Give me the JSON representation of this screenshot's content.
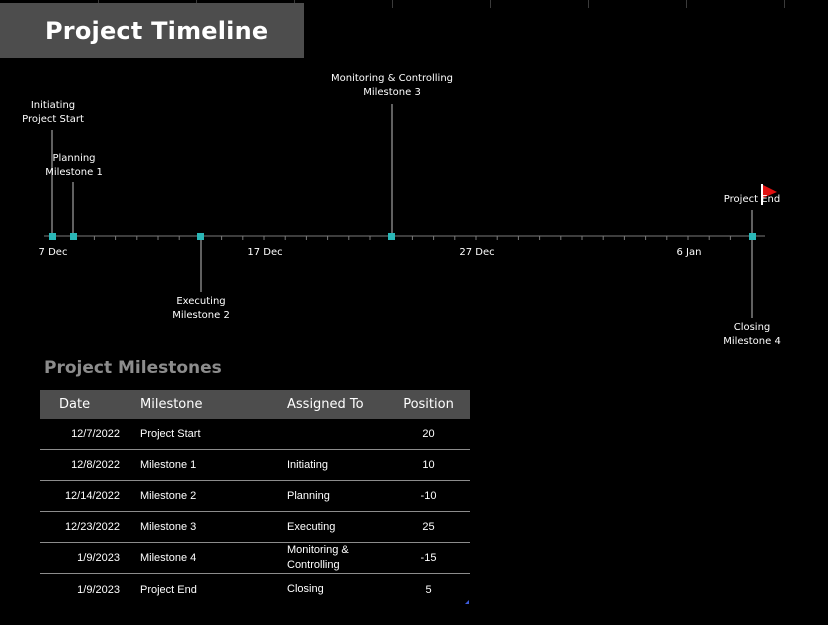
{
  "window": {
    "title": "Project Timeline"
  },
  "timeline": {
    "date_labels": [
      "7 Dec",
      "17 Dec",
      "27 Dec",
      "6 Jan"
    ],
    "marker_color": "#2ab7b7",
    "flag_color": "#e01010",
    "events": [
      {
        "key": "initiating",
        "label": "Initiating\nProject Start"
      },
      {
        "key": "planning",
        "label": "Planning\nMilestone 1"
      },
      {
        "key": "executing",
        "label": "Executing\nMilestone 2"
      },
      {
        "key": "monitoring",
        "label": "Monitoring & Controlling\nMilestone 3"
      },
      {
        "key": "closing",
        "label": "Closing\nMilestone 4"
      },
      {
        "key": "end",
        "label": "Project End"
      }
    ]
  },
  "milestones": {
    "title": "Project Milestones",
    "columns": [
      "Date",
      "Milestone",
      "Assigned To",
      "Position"
    ],
    "rows": [
      {
        "date": "12/7/2022",
        "milestone": "Project Start",
        "assigned": "",
        "position": "20"
      },
      {
        "date": "12/8/2022",
        "milestone": "Milestone 1",
        "assigned": "Initiating",
        "position": "10"
      },
      {
        "date": "12/14/2022",
        "milestone": "Milestone 2",
        "assigned": "Planning",
        "position": "-10"
      },
      {
        "date": "12/23/2022",
        "milestone": "Milestone 3",
        "assigned": "Executing",
        "position": "25"
      },
      {
        "date": "1/9/2023",
        "milestone": "Milestone 4",
        "assigned": "Monitoring & Controlling",
        "position": "-15"
      },
      {
        "date": "1/9/2023",
        "milestone": "Project End",
        "assigned": "Closing",
        "position": "5"
      }
    ]
  }
}
